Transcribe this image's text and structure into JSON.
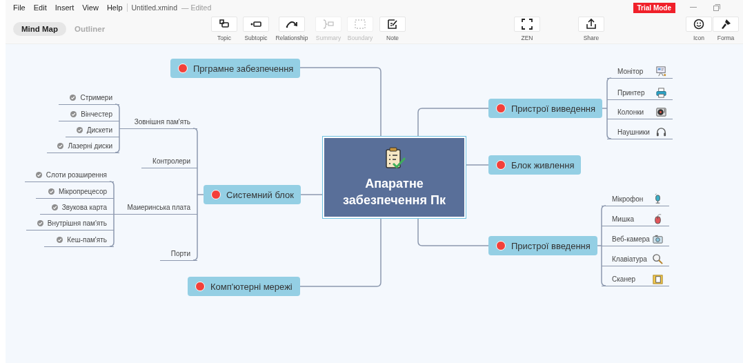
{
  "menu": [
    "File",
    "Edit",
    "Insert",
    "View",
    "Help"
  ],
  "document": {
    "name": "Untitled.xmind",
    "status": "— Edited"
  },
  "badge": "Trial Mode",
  "view_tabs": [
    {
      "label": "Mind Map",
      "selected": true
    },
    {
      "label": "Outliner",
      "selected": false
    }
  ],
  "toolbar": [
    {
      "label": "Topic",
      "disabled": false
    },
    {
      "label": "Subtopic",
      "disabled": false
    },
    {
      "label": "Relationship",
      "disabled": false
    },
    {
      "label": "Summary",
      "disabled": true
    },
    {
      "label": "Boundary",
      "disabled": true
    },
    {
      "label": "Note",
      "disabled": false
    },
    {
      "label": "ZEN",
      "disabled": false
    },
    {
      "label": "Share",
      "disabled": false
    },
    {
      "label": "Icon",
      "disabled": false
    },
    {
      "label": "Forma",
      "disabled": false
    }
  ],
  "map": {
    "central": "Апаратне забезпечення Пк",
    "topics": [
      {
        "title": "Прграмне забезпечення"
      },
      {
        "title": "Пристрої виведення",
        "children": [
          {
            "title": "Монітор",
            "checked": false
          },
          {
            "title": "Принтер",
            "checked": false
          },
          {
            "title": "Колонки",
            "checked": false
          },
          {
            "title": "Наушники",
            "checked": false
          }
        ]
      },
      {
        "title": "Блок живлення"
      },
      {
        "title": "Системний блок",
        "children": [
          {
            "title": "Зовнішня пам'ять",
            "checked": false,
            "children": [
              {
                "title": "Стримери",
                "checked": true
              },
              {
                "title": "Вінчестер",
                "checked": true
              },
              {
                "title": "Дискети",
                "checked": true
              },
              {
                "title": "Лазерні диски",
                "checked": true
              }
            ]
          },
          {
            "title": "Контролери",
            "checked": false
          },
          {
            "title": "Маиеринська плата",
            "checked": false,
            "children": [
              {
                "title": "Слоти розширення",
                "checked": true
              },
              {
                "title": "Мікропрецесор",
                "checked": true
              },
              {
                "title": "Звукова карта",
                "checked": true
              },
              {
                "title": "Внутрішня пам'ять",
                "checked": true
              },
              {
                "title": "Кеш-пам'ять",
                "checked": true
              }
            ]
          },
          {
            "title": "Порти",
            "checked": false
          }
        ]
      },
      {
        "title": "Пристрої введення",
        "children": [
          {
            "title": "Мікрофон",
            "checked": false
          },
          {
            "title": "Мишка",
            "checked": false
          },
          {
            "title": "Веб-камера",
            "checked": false
          },
          {
            "title": "Клавіатура",
            "checked": false
          },
          {
            "title": "Сканер",
            "checked": false
          }
        ]
      },
      {
        "title": "Комп'ютерні мережі"
      }
    ]
  }
}
